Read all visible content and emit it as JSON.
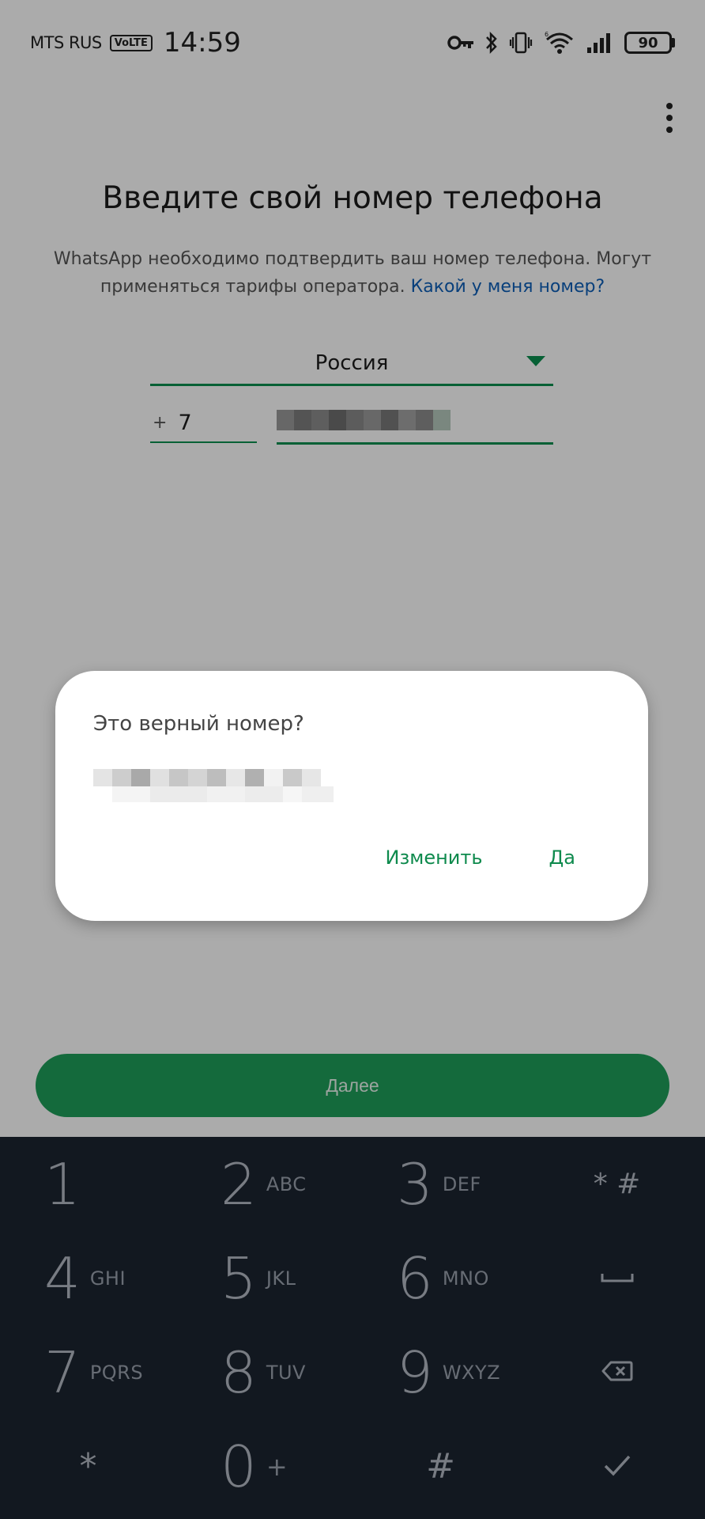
{
  "status_bar": {
    "carrier": "MTS RUS",
    "volte": "VoLTE",
    "time": "14:59",
    "battery": "90"
  },
  "registration": {
    "title": "Введите свой номер телефона",
    "description": "WhatsApp необходимо подтвердить ваш номер телефона. Могут применяться тарифы оператора.",
    "help_link": "Какой у меня номер?",
    "country": "Россия",
    "plus": "+",
    "country_code": "7",
    "next_label": "Далее"
  },
  "dialog": {
    "title": "Это верный номер?",
    "edit_label": "Изменить",
    "confirm_label": "Да"
  },
  "keypad": {
    "keys": [
      {
        "digit": "1",
        "letters": ""
      },
      {
        "digit": "2",
        "letters": "ABC"
      },
      {
        "digit": "3",
        "letters": "DEF"
      },
      {
        "digit": "4",
        "letters": "GHI"
      },
      {
        "digit": "5",
        "letters": "JKL"
      },
      {
        "digit": "6",
        "letters": "MNO"
      },
      {
        "digit": "7",
        "letters": "PQRS"
      },
      {
        "digit": "8",
        "letters": "TUV"
      },
      {
        "digit": "9",
        "letters": "WXYZ"
      },
      {
        "digit": "0",
        "letters": "+"
      }
    ],
    "star_hash_label": "* #",
    "star_label": "*",
    "hash_label": "#"
  },
  "colors": {
    "accent_green": "#0b8f4f",
    "button_green": "#1e9e5a",
    "link_blue": "#0d5fb8",
    "keypad_bg": "#1b2430"
  }
}
